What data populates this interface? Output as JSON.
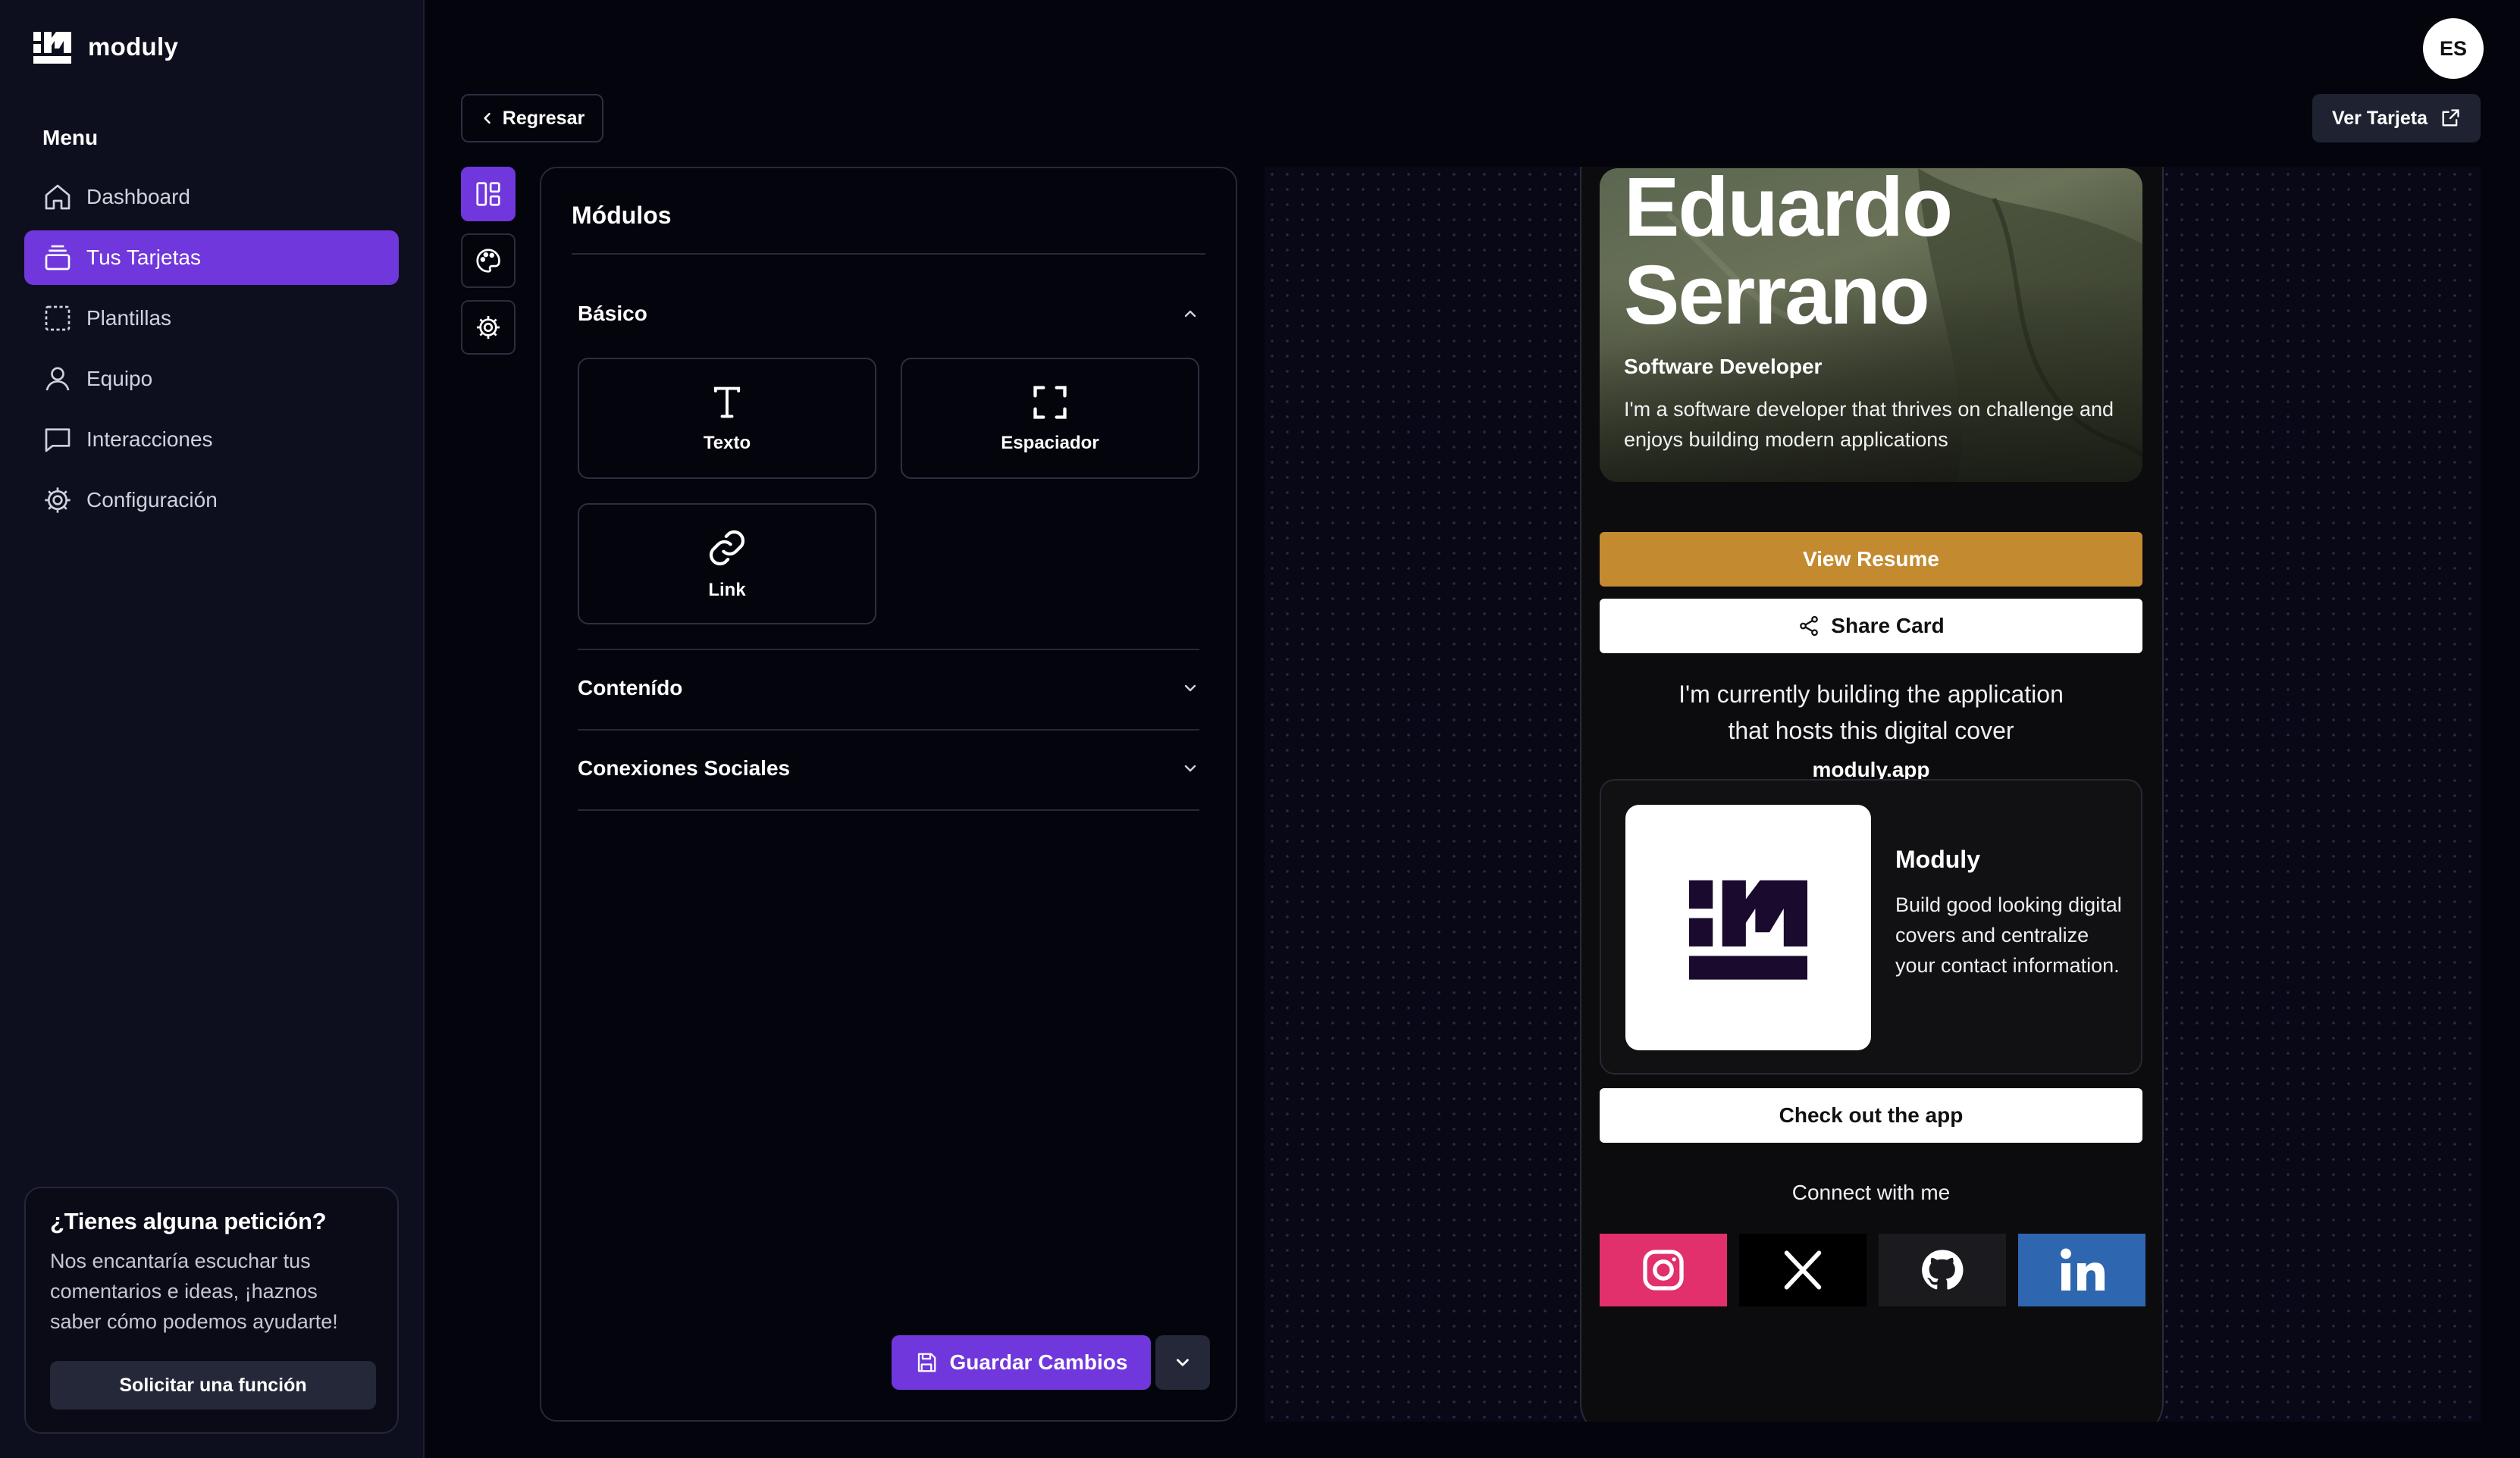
{
  "app": {
    "name": "moduly"
  },
  "sidebar": {
    "menu_heading": "Menu",
    "items": [
      {
        "label": "Dashboard",
        "icon": "home-icon"
      },
      {
        "label": "Tus Tarjetas",
        "icon": "cards-icon",
        "active": true
      },
      {
        "label": "Plantillas",
        "icon": "template-icon"
      },
      {
        "label": "Equipo",
        "icon": "user-icon"
      },
      {
        "label": "Interacciones",
        "icon": "chat-icon"
      },
      {
        "label": "Configuración",
        "icon": "gear-icon"
      }
    ],
    "request": {
      "title": "¿Tienes alguna petición?",
      "body": "Nos encantaría escuchar tus comentarios e ideas, ¡haznos saber cómo podemos ayudarte!",
      "button": "Solicitar una función"
    }
  },
  "header": {
    "avatar": "ES",
    "back": "Regresar",
    "view_card": "Ver Tarjeta"
  },
  "modules": {
    "title": "Módulos",
    "sections": [
      {
        "label": "Básico",
        "expanded": true
      },
      {
        "label": "Contenído",
        "expanded": false
      },
      {
        "label": "Conexiones Sociales",
        "expanded": false
      }
    ],
    "basic_items": [
      {
        "label": "Texto",
        "icon": "text-icon"
      },
      {
        "label": "Espaciador",
        "icon": "spacer-icon"
      },
      {
        "label": "Link",
        "icon": "link-icon"
      }
    ],
    "save": "Guardar Cambios"
  },
  "card": {
    "name_first": "Eduardo",
    "name_last": "Serrano",
    "role": "Software Developer",
    "bio": "I'm a software developer that thrives on challenge and enjoys building modern applications",
    "resume_button": "View Resume",
    "share_button": "Share Card",
    "text_line1": "I'm currently building the application",
    "text_line2": "that hosts this digital cover",
    "text_link": "moduly.app",
    "app": {
      "name": "Moduly",
      "description": "Build good looking digital covers and centralize your contact information.",
      "button": "Check out the app"
    },
    "connect_label": "Connect with me",
    "socials": [
      {
        "name": "instagram-icon",
        "color": "#e1306c"
      },
      {
        "name": "x-icon",
        "color": "#000000"
      },
      {
        "name": "github-icon",
        "color": "#1b1b1f"
      },
      {
        "name": "linkedin-icon",
        "color": "#2f66b0"
      }
    ]
  },
  "colors": {
    "accent": "#7037dd",
    "resume": "#c48a2f"
  }
}
